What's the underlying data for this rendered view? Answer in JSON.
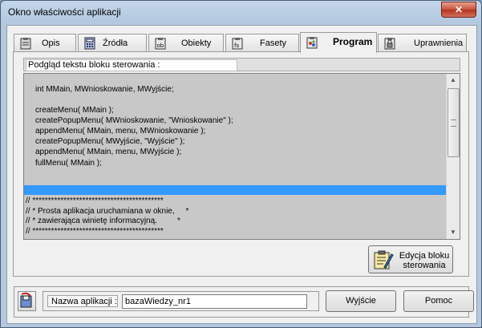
{
  "window": {
    "title": "Okno właściwości aplikacji",
    "close_glyph": "✕"
  },
  "tabs": [
    {
      "label": "Opis",
      "icon": "clipboard-icon",
      "active": false
    },
    {
      "label": "Źródła",
      "icon": "calculator-icon",
      "active": false
    },
    {
      "label": "Obiekty",
      "icon": "objects-icon",
      "active": false
    },
    {
      "label": "Fasety",
      "icon": "facets-icon",
      "active": false
    },
    {
      "label": "Program",
      "icon": "program-icon",
      "active": true
    },
    {
      "label": "Uprawnienia",
      "icon": "permissions-icon",
      "active": false
    }
  ],
  "preview": {
    "header": "Podgląd tekstu bloku sterowania :",
    "code_lines": [
      "int MMain, MWnioskowanie, MWyjście;",
      "",
      "createMenu( MMain );",
      "createPopupMenu( MWnioskowanie, \"Wnioskowanie\" );",
      "appendMenu( MMain, menu, MWnioskowanie );",
      "createPopupMenu( MWyjście, \"Wyjście\" );",
      "appendMenu( MMain, menu, MWyjście );",
      "fullMenu( MMain );"
    ],
    "comment_lines": [
      "// ******************************************",
      "// * Prosta aplikacja uruchamiana w oknie,     *",
      "// * zawierająca winietę informacyjną.         *",
      "// ******************************************"
    ]
  },
  "edit_button": {
    "label": "Edycja bloku\nsterowania",
    "icon": "edit-block-icon"
  },
  "bottom": {
    "name_label": "Nazwa aplikacji :",
    "name_value": "bazaWiedzy_nr1",
    "exit_label": "Wyjście",
    "help_label": "Pomoc",
    "save_icon": "save-icon"
  },
  "colors": {
    "selection": "#3399ff",
    "editor_bg": "#c8c8c8"
  }
}
